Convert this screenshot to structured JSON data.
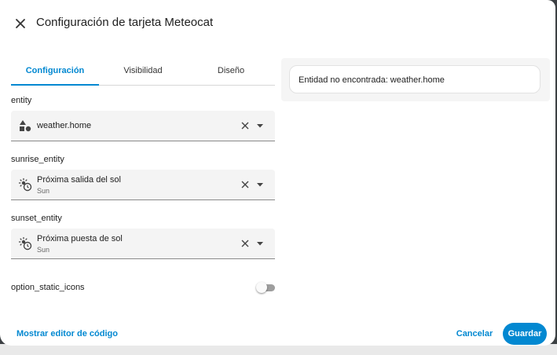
{
  "dialog": {
    "title": "Configuración de tarjeta Meteocat",
    "close_icon": "close-icon"
  },
  "tabs": [
    {
      "label": "Configuración",
      "active": true
    },
    {
      "label": "Visibilidad",
      "active": false
    },
    {
      "label": "Diseño",
      "active": false
    }
  ],
  "fields": {
    "entity": {
      "label": "entity",
      "value": "weather.home",
      "icon": "shapes-icon"
    },
    "sunrise_entity": {
      "label": "sunrise_entity",
      "value": "Próxima salida del sol",
      "secondary": "Sun",
      "icon": "sun-clock-icon"
    },
    "sunset_entity": {
      "label": "sunset_entity",
      "value": "Próxima puesta de sol",
      "secondary": "Sun",
      "icon": "sun-clock-icon"
    }
  },
  "toggle": {
    "label": "option_static_icons",
    "checked": false
  },
  "preview": {
    "error": "Entidad no encontrada: weather.home"
  },
  "footer": {
    "code_editor": "Mostrar editor de código",
    "cancel": "Cancelar",
    "save": "Guardar"
  },
  "colors": {
    "accent": "#0288d1",
    "field_bg": "#f4f4f4"
  }
}
